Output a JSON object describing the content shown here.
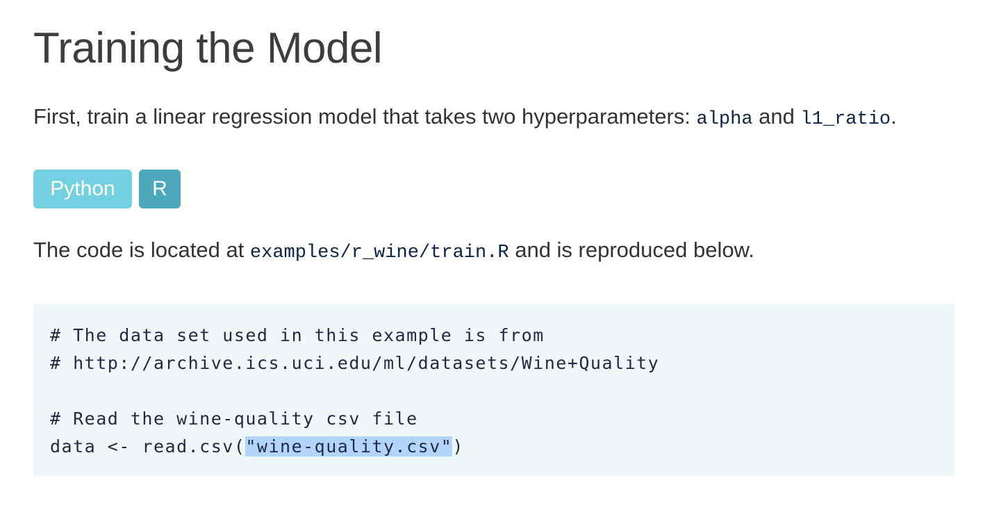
{
  "heading": "Training the Model",
  "intro": {
    "prefix": "First, train a linear regression model that takes two hyperparameters: ",
    "param1": "alpha",
    "middle": " and ",
    "param2": "l1_ratio",
    "suffix": "."
  },
  "tabs": [
    {
      "label": "Python"
    },
    {
      "label": "R"
    }
  ],
  "location": {
    "prefix": "The code is located at ",
    "path": "examples/r_wine/train.R",
    "suffix": " and is reproduced below."
  },
  "code": {
    "line1": "# The data set used in this example is from",
    "line2": "# http://archive.ics.uci.edu/ml/datasets/Wine+Quality",
    "line3": "",
    "line4": "# Read the wine-quality csv file",
    "line5_prefix": "data <- read.csv(",
    "line5_selected": "\"wine-quality.csv\"",
    "line5_suffix": ")"
  }
}
